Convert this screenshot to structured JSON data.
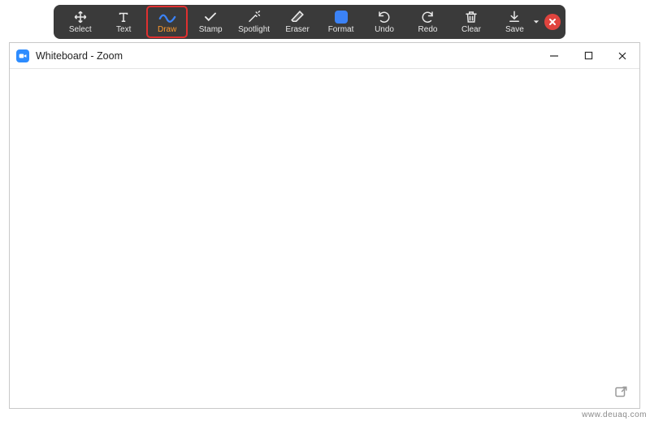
{
  "toolbar": {
    "tools": [
      {
        "id": "select",
        "label": "Select",
        "active": false,
        "highlighted": false
      },
      {
        "id": "text",
        "label": "Text",
        "active": false,
        "highlighted": false
      },
      {
        "id": "draw",
        "label": "Draw",
        "active": true,
        "highlighted": true
      },
      {
        "id": "stamp",
        "label": "Stamp",
        "active": false,
        "highlighted": false
      },
      {
        "id": "spotlight",
        "label": "Spotlight",
        "active": false,
        "highlighted": false
      },
      {
        "id": "eraser",
        "label": "Eraser",
        "active": false,
        "highlighted": false
      },
      {
        "id": "format",
        "label": "Format",
        "active": false,
        "highlighted": false
      },
      {
        "id": "undo",
        "label": "Undo",
        "active": false,
        "highlighted": false
      },
      {
        "id": "redo",
        "label": "Redo",
        "active": false,
        "highlighted": false
      },
      {
        "id": "clear",
        "label": "Clear",
        "active": false,
        "highlighted": false
      },
      {
        "id": "save",
        "label": "Save",
        "active": false,
        "highlighted": false
      }
    ],
    "format_color": "#3b82f6"
  },
  "window": {
    "title": "Whiteboard - Zoom"
  },
  "watermark": "www.deuaq.com"
}
